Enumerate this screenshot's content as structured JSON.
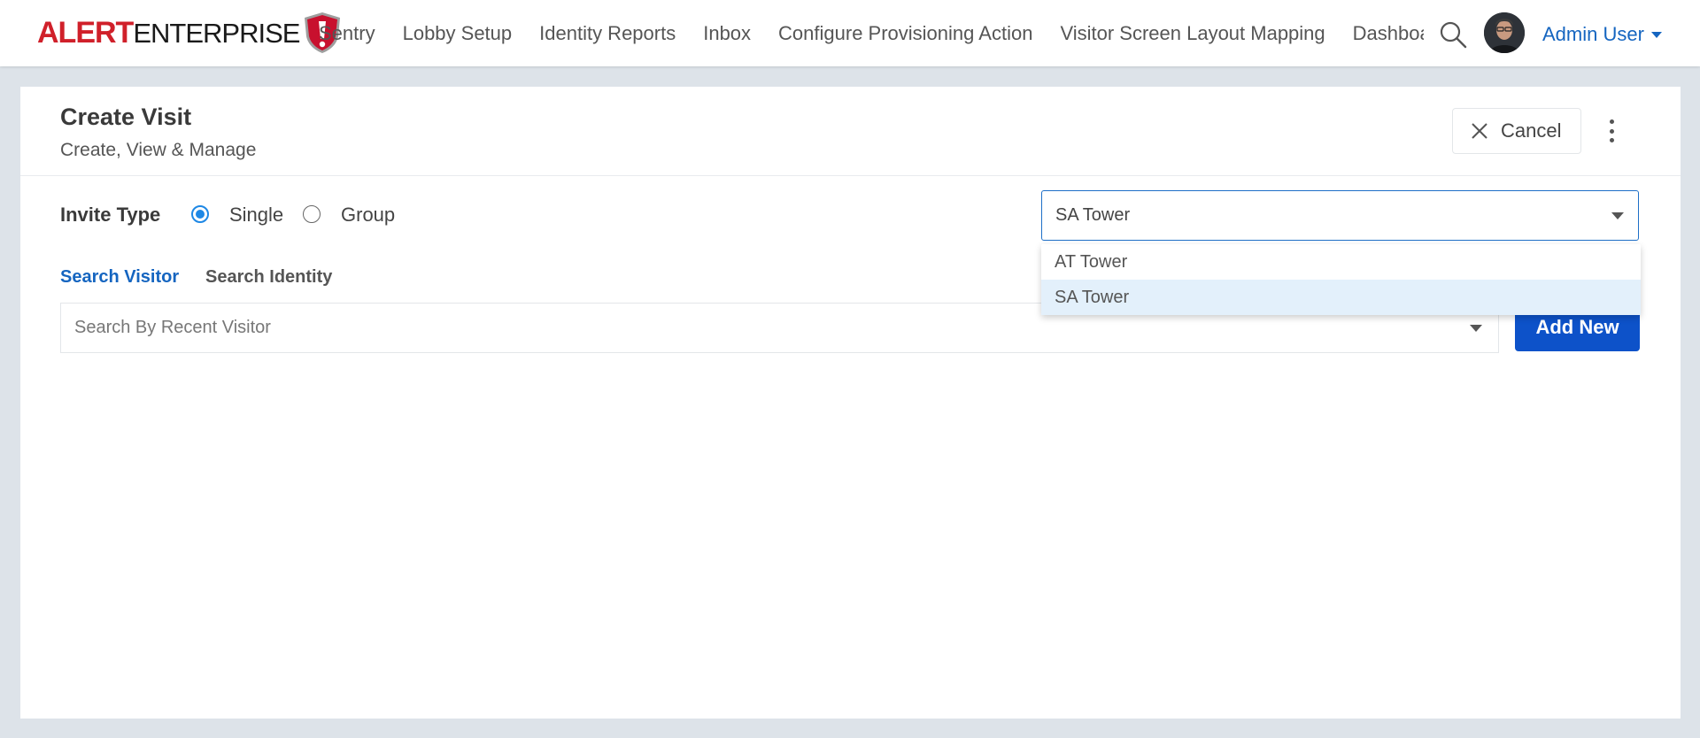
{
  "brand": {
    "logo_alert": "ALERT",
    "logo_enterprise": "ENTERPRISE",
    "accent_color": "#d0202a"
  },
  "nav": {
    "items": [
      "Sentry",
      "Lobby Setup",
      "Identity Reports",
      "Inbox",
      "Configure Provisioning Action",
      "Visitor Screen Layout Mapping",
      "Dashboards"
    ],
    "search_icon": "search-icon",
    "user_name": "Admin User",
    "link_color": "#1565c0"
  },
  "header": {
    "title": "Create Visit",
    "subtitle": "Create, View & Manage",
    "cancel_label": "Cancel",
    "cancel_icon": "close-icon",
    "more_icon": "kebab-menu-icon"
  },
  "invite": {
    "label": "Invite Type",
    "options": [
      "Single",
      "Group"
    ],
    "selected": "Single"
  },
  "location": {
    "selected": "SA Tower",
    "options": [
      "AT Tower",
      "SA Tower"
    ]
  },
  "tabs": {
    "items": [
      "Search Visitor",
      "Search Identity"
    ],
    "active": "Search Visitor"
  },
  "visitor_search": {
    "placeholder": "Search By Recent Visitor",
    "value": ""
  },
  "actions": {
    "add_new_label": "Add New",
    "primary_color": "#0d52c9"
  }
}
